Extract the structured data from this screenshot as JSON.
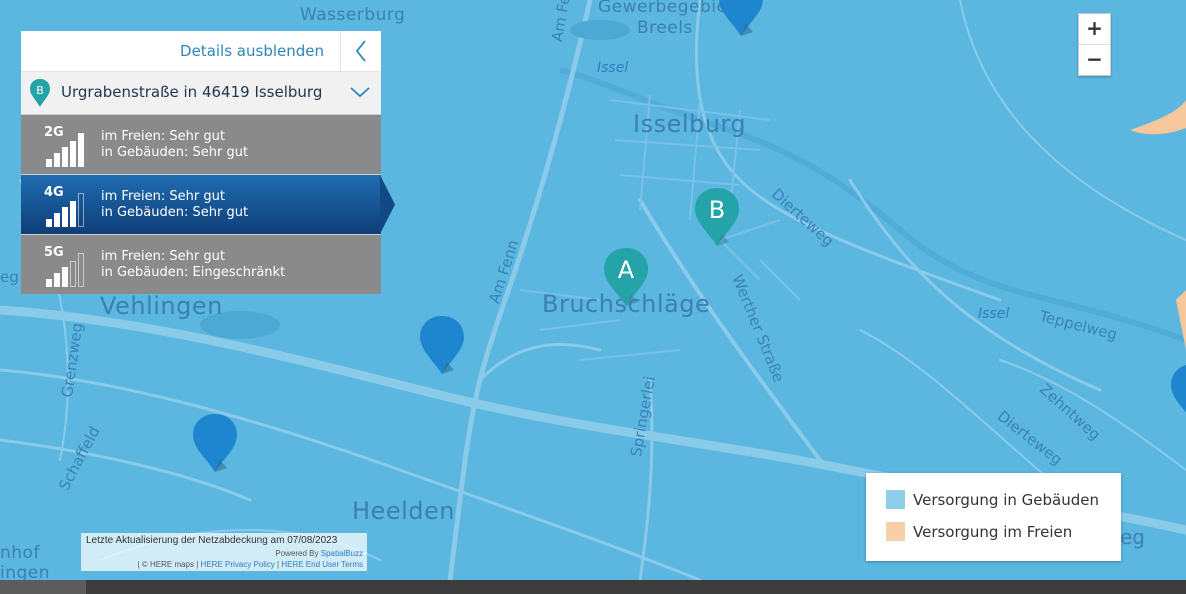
{
  "panel": {
    "hide_details": "Details ausblenden",
    "address": "Urgrabenstraße in 46419 Isselburg",
    "address_marker": "B",
    "rows": [
      {
        "gen": "2G",
        "outdoor": "im Freien: Sehr gut",
        "indoor": "in Gebäuden: Sehr gut",
        "bars": 5,
        "active": false
      },
      {
        "gen": "4G",
        "outdoor": "im Freien: Sehr gut",
        "indoor": "in Gebäuden: Sehr gut",
        "bars": 4,
        "active": true
      },
      {
        "gen": "5G",
        "outdoor": "im Freien: Sehr gut",
        "indoor": "in Gebäuden: Eingeschränkt",
        "bars": 3,
        "active": false
      }
    ]
  },
  "zoom": {
    "in": "+",
    "out": "−"
  },
  "map": {
    "places": [
      "Wasserburg",
      "Gewerbegebiet",
      "Breels",
      "Isselburg",
      "Bruchschläge",
      "Vehlingen",
      "Heelden",
      "nhof",
      "ingen"
    ],
    "streets": [
      "Am Fenn",
      "Am Fenn",
      "Dierteweg",
      "Werther Straße",
      "Teppelweg",
      "Zehntweg",
      "Dierteweg",
      "Springerlei",
      "Grenzweg",
      "Schaffeld",
      "eg",
      "eg"
    ],
    "water": [
      "Issel",
      "Issel"
    ],
    "markers": [
      {
        "label": "A",
        "color": "#24a3a8"
      },
      {
        "label": "B",
        "color": "#24a3a8"
      },
      {
        "label": "",
        "color": "#1e86cf"
      },
      {
        "label": "",
        "color": "#1e86cf"
      },
      {
        "label": "",
        "color": "#1e86cf"
      },
      {
        "label": "",
        "color": "#1e86cf"
      }
    ]
  },
  "legend": {
    "items": [
      {
        "label": "Versorgung in Gebäuden",
        "color": "#8ccfe6"
      },
      {
        "label": "Versorgung im Freien",
        "color": "#f6d0a6"
      }
    ]
  },
  "attribution": {
    "updated": "Letzte Aktualisierung der Netzabdeckung am 07/08/2023",
    "powered_by": "Powered By",
    "powered_link": "SpatialBuzz",
    "here_maps": "| © HERE maps |",
    "privacy": "HERE Privacy Policy",
    "sep": "|",
    "terms": "HERE End User Terms"
  },
  "colors": {
    "map": "#5bb6e0",
    "road": "#8bcbea",
    "active": "#124985",
    "inactive": "#8a8a8a"
  }
}
